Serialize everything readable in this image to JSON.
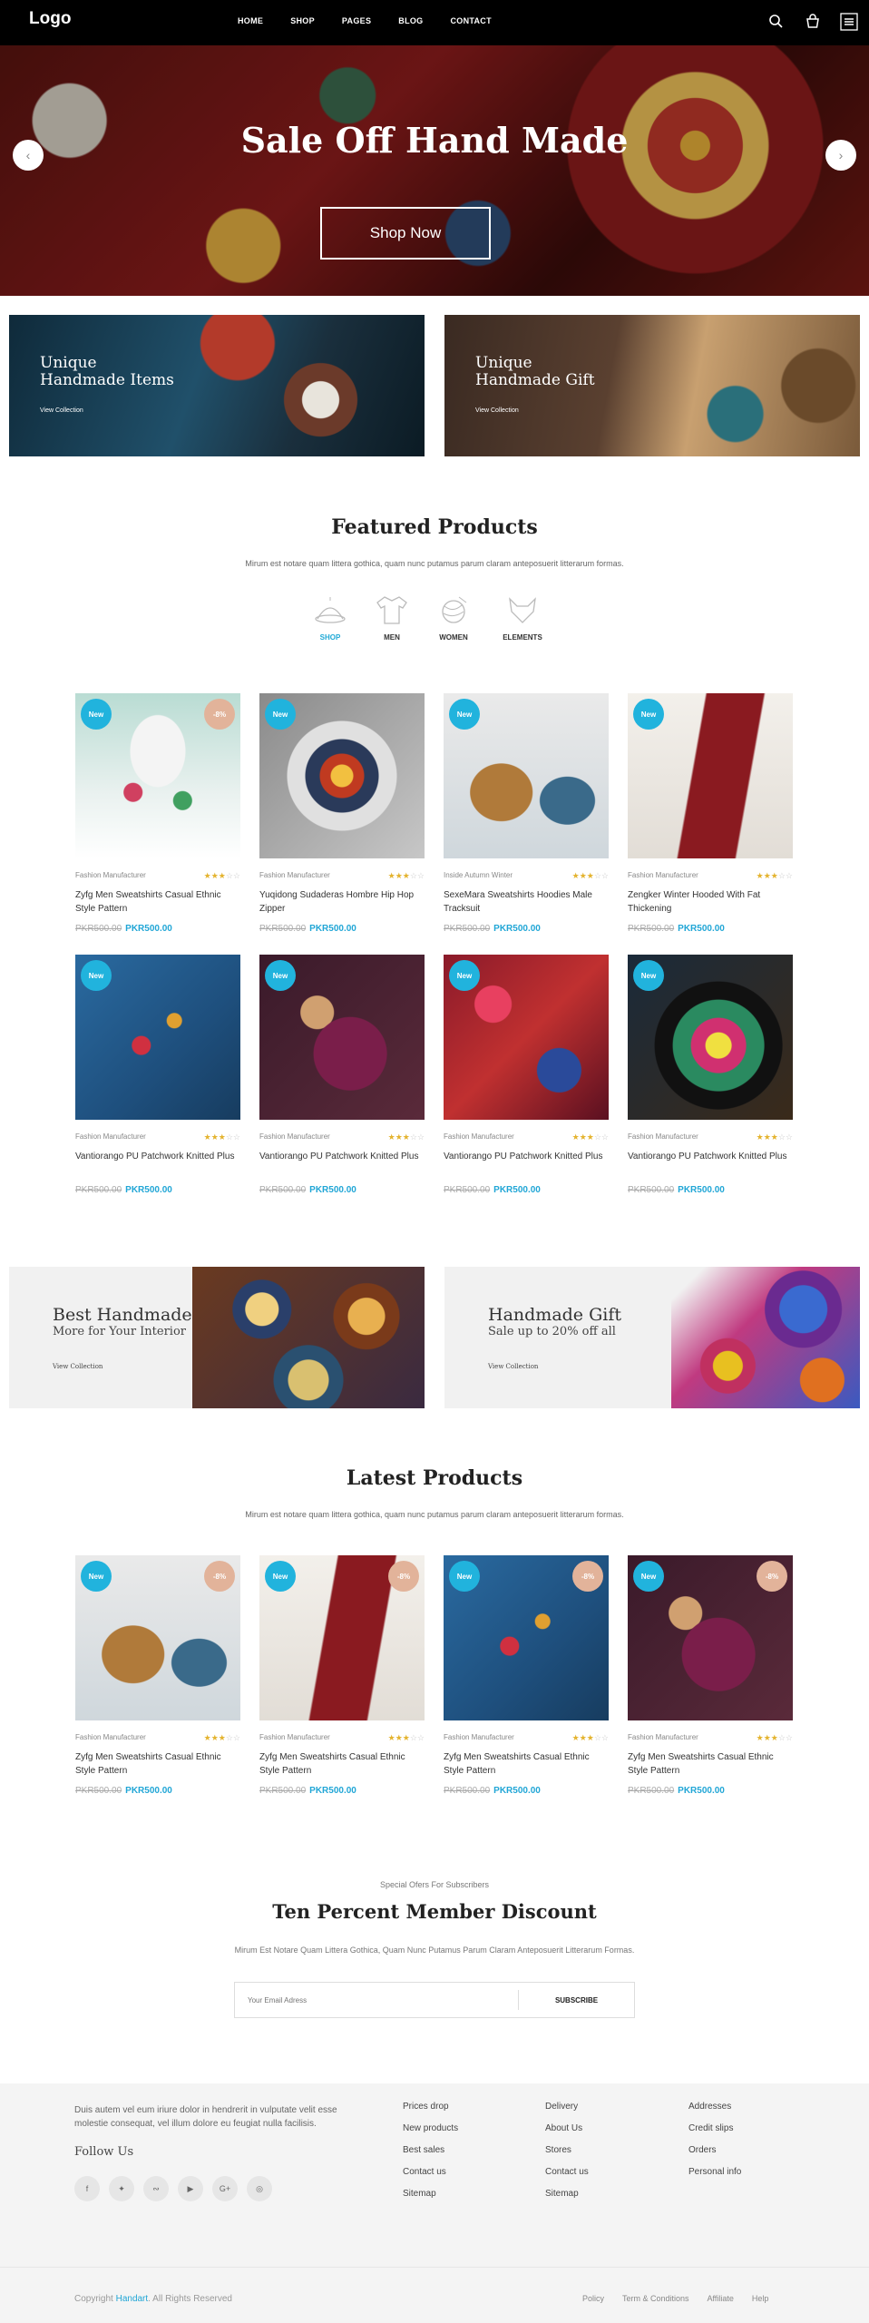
{
  "header": {
    "logo": "Logo",
    "nav": [
      "HOME",
      "SHOP",
      "PAGES",
      "BLOG",
      "CONTACT"
    ]
  },
  "hero": {
    "title": "Sale Off Hand Made",
    "button": "Shop Now"
  },
  "promos": [
    {
      "title1": "Unique",
      "title2": "Handmade Items",
      "link": "View Collection"
    },
    {
      "title1": "Unique",
      "title2": "Handmade Gift",
      "link": "View Collection"
    }
  ],
  "featured": {
    "title": "Featured Products",
    "subtitle": "Mirum est notare quam littera gothica, quam nunc putamus parum claram anteposuerit litterarum formas.",
    "categories": [
      "SHOP",
      "MEN",
      "WOMEN",
      "ELEMENTS"
    ],
    "products": [
      {
        "maker": "Fashion Manufacturer",
        "name": "Zyfg Men Sweatshirts Casual Ethnic Style Pattern",
        "old": "PKR500.00",
        "price": "PKR500.00",
        "badge": "New",
        "off": "-8%",
        "rating": 3
      },
      {
        "maker": "Fashion Manufacturer",
        "name": "Yuqidong Sudaderas Hombre Hip Hop Zipper",
        "old": "PKR500.00",
        "price": "PKR500.00",
        "badge": "New",
        "off": "",
        "rating": 3
      },
      {
        "maker": "Inside Autumn Winter",
        "name": "SexeMara Sweatshirts Hoodies Male Tracksuit",
        "old": "PKR500.00",
        "price": "PKR500.00",
        "badge": "New",
        "off": "",
        "rating": 3
      },
      {
        "maker": "Fashion Manufacturer",
        "name": "Zengker Winter Hooded With Fat Thickening",
        "old": "PKR500.00",
        "price": "PKR500.00",
        "badge": "New",
        "off": "",
        "rating": 3
      },
      {
        "maker": "Fashion Manufacturer",
        "name": "Vantiorango PU Patchwork Knitted Plus",
        "old": "PKR500.00",
        "price": "PKR500.00",
        "badge": "New",
        "off": "",
        "rating": 3
      },
      {
        "maker": "Fashion Manufacturer",
        "name": "Vantiorango PU Patchwork Knitted Plus",
        "old": "PKR500.00",
        "price": "PKR500.00",
        "badge": "New",
        "off": "",
        "rating": 3
      },
      {
        "maker": "Fashion Manufacturer",
        "name": "Vantiorango PU Patchwork Knitted Plus",
        "old": "PKR500.00",
        "price": "PKR500.00",
        "badge": "New",
        "off": "",
        "rating": 3
      },
      {
        "maker": "Fashion Manufacturer",
        "name": "Vantiorango PU Patchwork Knitted Plus",
        "old": "PKR500.00",
        "price": "PKR500.00",
        "badge": "New",
        "off": "",
        "rating": 3
      }
    ]
  },
  "mid_banners": [
    {
      "line1": "Best Handmade",
      "line2": "More for Your Interior",
      "link": "View Collection"
    },
    {
      "line1": "Handmade Gift",
      "line2": "Sale up to 20% off all",
      "link": "View Collection"
    }
  ],
  "latest": {
    "title": "Latest Products",
    "subtitle": "Mirum est notare quam littera gothica, quam nunc putamus parum claram anteposuerit litterarum formas.",
    "products": [
      {
        "maker": "Fashion Manufacturer",
        "name": "Zyfg Men Sweatshirts Casual Ethnic Style Pattern",
        "old": "PKR500.00",
        "price": "PKR500.00",
        "badge": "New",
        "off": "-8%",
        "rating": 3
      },
      {
        "maker": "Fashion Manufacturer",
        "name": "Zyfg Men Sweatshirts Casual Ethnic Style Pattern",
        "old": "PKR500.00",
        "price": "PKR500.00",
        "badge": "New",
        "off": "-8%",
        "rating": 3
      },
      {
        "maker": "Fashion Manufacturer",
        "name": "Zyfg Men Sweatshirts Casual Ethnic Style Pattern",
        "old": "PKR500.00",
        "price": "PKR500.00",
        "badge": "New",
        "off": "-8%",
        "rating": 3
      },
      {
        "maker": "Fashion Manufacturer",
        "name": "Zyfg Men Sweatshirts Casual Ethnic Style Pattern",
        "old": "PKR500.00",
        "price": "PKR500.00",
        "badge": "New",
        "off": "-8%",
        "rating": 3
      }
    ]
  },
  "subscribe": {
    "kicker": "Special Ofers For Subscribers",
    "title": "Ten Percent Member Discount",
    "text": "Mirum Est Notare Quam Littera Gothica, Quam Nunc Putamus Parum Claram Anteposuerit Litterarum Formas.",
    "placeholder": "Your Email Adress",
    "button": "SUBSCRIBE"
  },
  "footer": {
    "about": "Duis autem vel eum iriure dolor in hendrerit in vulputate velit esse molestie consequat, vel illum dolore eu feugiat nulla facilisis.",
    "follow": "Follow Us",
    "col1": [
      "Prices drop",
      "New products",
      "Best sales",
      "Contact us",
      "Sitemap"
    ],
    "col2": [
      "Delivery",
      "About Us",
      "Stores",
      "Contact us",
      "Sitemap"
    ],
    "col3": [
      "Addresses",
      "Credit slips",
      "Orders",
      "Personal info"
    ],
    "copyright_prefix": "Copyright",
    "brand": "Handart",
    "copyright_suffix": ". All Rights Reserved",
    "links": [
      "Policy",
      "Term & Conditions",
      "Affiliate",
      "Help"
    ]
  },
  "colors": {
    "accent": "#21a6d6",
    "star": "#e4b32e",
    "badge_off": "#e2b39a"
  }
}
